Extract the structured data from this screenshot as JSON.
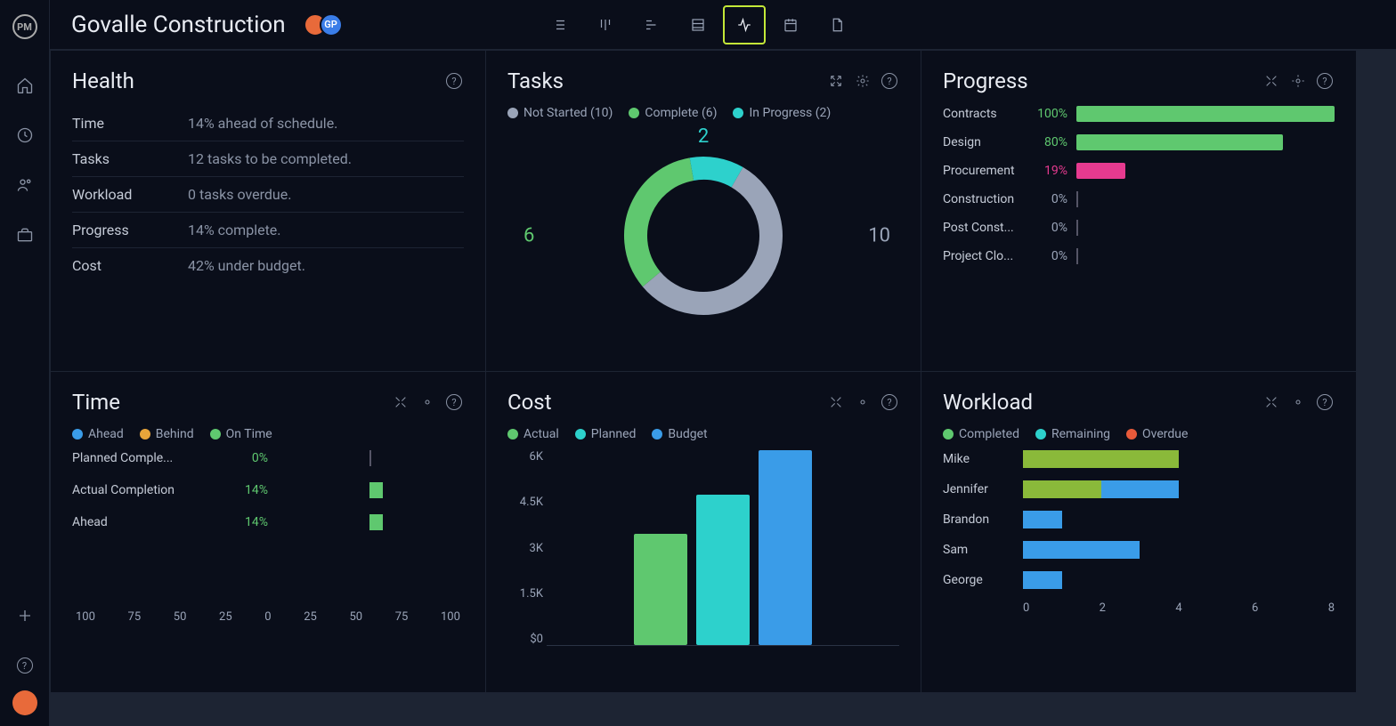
{
  "app": {
    "logo": "PM"
  },
  "project": {
    "title": "Govalle Construction",
    "avatar2": "GP"
  },
  "viewTabs": [
    "list",
    "kanban",
    "gantt",
    "table",
    "activity",
    "calendar",
    "docs"
  ],
  "health": {
    "title": "Health",
    "rows": [
      {
        "label": "Time",
        "value": "14% ahead of schedule."
      },
      {
        "label": "Tasks",
        "value": "12 tasks to be completed."
      },
      {
        "label": "Workload",
        "value": "0 tasks overdue."
      },
      {
        "label": "Progress",
        "value": "14% complete."
      },
      {
        "label": "Cost",
        "value": "42% under budget."
      }
    ]
  },
  "tasks": {
    "title": "Tasks",
    "legend": [
      {
        "label": "Not Started (10)",
        "color": "#9aa4b8"
      },
      {
        "label": "Complete (6)",
        "color": "#5fc86f"
      },
      {
        "label": "In Progress (2)",
        "color": "#2dd1cc"
      }
    ]
  },
  "progress": {
    "title": "Progress",
    "items": [
      {
        "name": "Contracts",
        "pct": "100%",
        "width": 100,
        "color": "#5fc86f",
        "pcolor": "#5fc86f"
      },
      {
        "name": "Design",
        "pct": "80%",
        "width": 80,
        "color": "#5fc86f",
        "pcolor": "#5fc86f"
      },
      {
        "name": "Procurement",
        "pct": "19%",
        "width": 19,
        "color": "#e63a8f",
        "pcolor": "#e63a8f"
      },
      {
        "name": "Construction",
        "pct": "0%",
        "width": 0,
        "color": "#9aa4b8",
        "pcolor": "#9aa4b8"
      },
      {
        "name": "Post Const...",
        "pct": "0%",
        "width": 0,
        "color": "#9aa4b8",
        "pcolor": "#9aa4b8"
      },
      {
        "name": "Project Clo...",
        "pct": "0%",
        "width": 0,
        "color": "#9aa4b8",
        "pcolor": "#9aa4b8"
      }
    ]
  },
  "time": {
    "title": "Time",
    "legend": [
      {
        "label": "Ahead",
        "color": "#3a9ce8"
      },
      {
        "label": "Behind",
        "color": "#e8a53a"
      },
      {
        "label": "On Time",
        "color": "#5fc86f"
      }
    ],
    "rows": [
      {
        "label": "Planned Comple...",
        "pct": "0%",
        "width": 0
      },
      {
        "label": "Actual Completion",
        "pct": "14%",
        "width": 14
      },
      {
        "label": "Ahead",
        "pct": "14%",
        "width": 14
      }
    ],
    "axis": [
      "100",
      "75",
      "50",
      "25",
      "0",
      "25",
      "50",
      "75",
      "100"
    ]
  },
  "cost": {
    "title": "Cost",
    "legend": [
      {
        "label": "Actual",
        "color": "#5fc86f"
      },
      {
        "label": "Planned",
        "color": "#2dd1cc"
      },
      {
        "label": "Budget",
        "color": "#3a9ce8"
      }
    ],
    "yticks": [
      "6K",
      "4.5K",
      "3K",
      "1.5K",
      "$0"
    ]
  },
  "workload": {
    "title": "Workload",
    "legend": [
      {
        "label": "Completed",
        "color": "#5fc86f"
      },
      {
        "label": "Remaining",
        "color": "#2dd1cc"
      },
      {
        "label": "Overdue",
        "color": "#e85a3a"
      }
    ],
    "people": [
      {
        "name": "Mike",
        "completed": 4,
        "remaining": 0
      },
      {
        "name": "Jennifer",
        "completed": 2,
        "remaining": 2
      },
      {
        "name": "Brandon",
        "completed": 0,
        "remaining": 1
      },
      {
        "name": "Sam",
        "completed": 0,
        "remaining": 3
      },
      {
        "name": "George",
        "completed": 0,
        "remaining": 1
      }
    ],
    "axis": [
      "0",
      "2",
      "4",
      "6",
      "8"
    ]
  },
  "chart_data": [
    {
      "type": "pie",
      "title": "Tasks",
      "series": [
        {
          "name": "Not Started",
          "value": 10
        },
        {
          "name": "Complete",
          "value": 6
        },
        {
          "name": "In Progress",
          "value": 2
        }
      ]
    },
    {
      "type": "bar",
      "title": "Progress",
      "categories": [
        "Contracts",
        "Design",
        "Procurement",
        "Construction",
        "Post Construction",
        "Project Closure"
      ],
      "values": [
        100,
        80,
        19,
        0,
        0,
        0
      ],
      "ylabel": "%",
      "ylim": [
        0,
        100
      ]
    },
    {
      "type": "bar",
      "title": "Time",
      "categories": [
        "Planned Completion",
        "Actual Completion",
        "Ahead"
      ],
      "values": [
        0,
        14,
        14
      ],
      "ylabel": "%",
      "xlim": [
        -100,
        100
      ]
    },
    {
      "type": "bar",
      "title": "Cost",
      "categories": [
        "Actual",
        "Planned",
        "Budget"
      ],
      "values": [
        3400,
        4600,
        6000
      ],
      "ylabel": "$",
      "ylim": [
        0,
        6000
      ]
    },
    {
      "type": "bar",
      "title": "Workload",
      "categories": [
        "Mike",
        "Jennifer",
        "Brandon",
        "Sam",
        "George"
      ],
      "series": [
        {
          "name": "Completed",
          "values": [
            4,
            2,
            0,
            0,
            0
          ]
        },
        {
          "name": "Remaining",
          "values": [
            0,
            2,
            1,
            3,
            1
          ]
        },
        {
          "name": "Overdue",
          "values": [
            0,
            0,
            0,
            0,
            0
          ]
        }
      ],
      "xlim": [
        0,
        8
      ]
    }
  ]
}
